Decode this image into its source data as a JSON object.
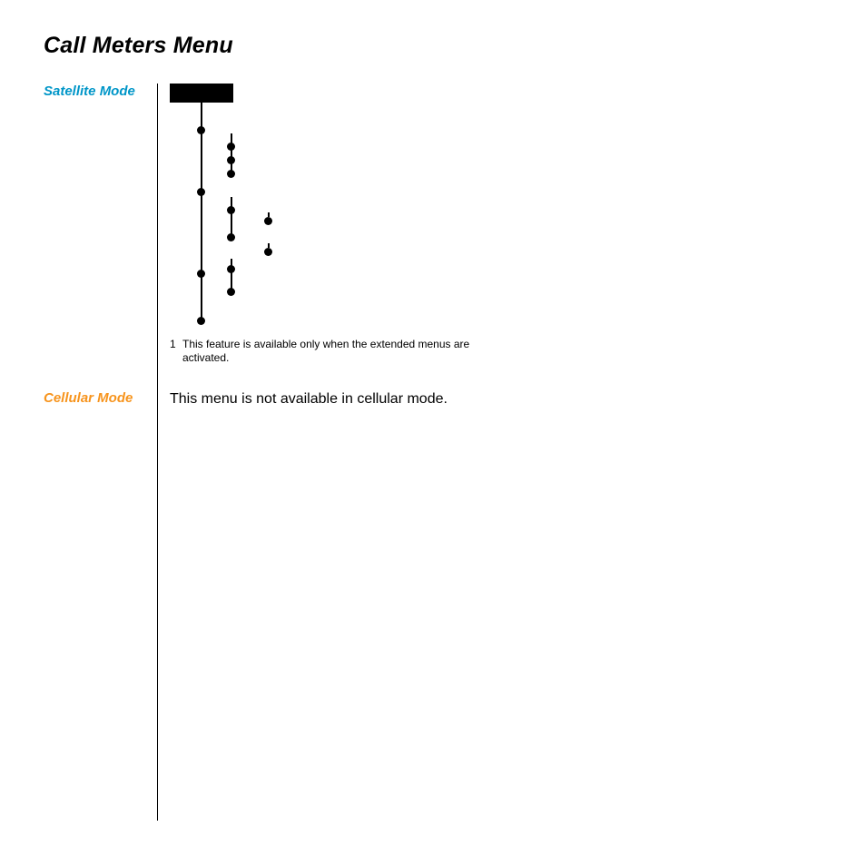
{
  "title": "Call Meters Menu",
  "sections": {
    "satellite": {
      "label": "Satellite Mode"
    },
    "cellular": {
      "label": "Cellular Mode",
      "body": "This menu is not available in cellular mode."
    }
  },
  "footnote": {
    "marker": "1",
    "text": "This feature is available only when the extended menus are activated."
  }
}
